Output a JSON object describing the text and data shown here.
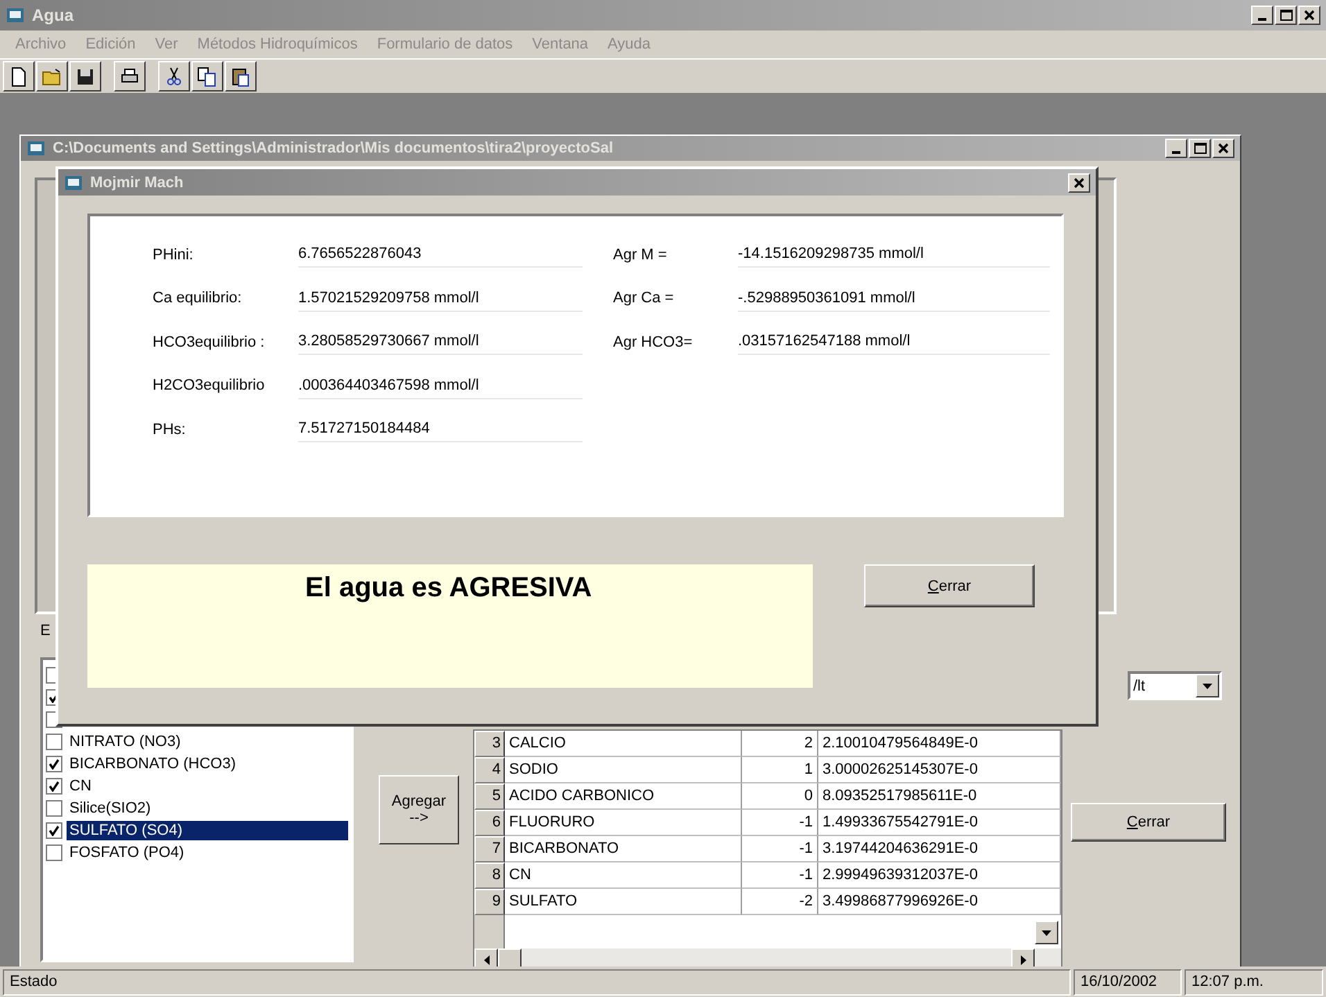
{
  "window": {
    "title": "Agua"
  },
  "menu": [
    "Archivo",
    "Edición",
    "Ver",
    "Métodos Hidroquímicos",
    "Formulario de datos",
    "Ventana",
    "Ayuda"
  ],
  "document_window": {
    "title": "C:\\Documents and Settings\\Administrador\\Mis documentos\\tira2\\proyectoSal",
    "label": "E",
    "list": [
      {
        "checked": false
      },
      {
        "checked": true
      },
      {
        "checked": false
      },
      {
        "label": "NITRATO (NO3)",
        "checked": false,
        "selected": false
      },
      {
        "label": "BICARBONATO (HCO3)",
        "checked": true,
        "selected": false
      },
      {
        "label": "CN",
        "checked": true,
        "selected": false
      },
      {
        "label": "Silice(SIO2)",
        "checked": false,
        "selected": false
      },
      {
        "label": "SULFATO (SO4)",
        "checked": true,
        "selected": true
      },
      {
        "label": "FOSFATO (PO4)",
        "checked": false,
        "selected": false
      }
    ],
    "add_button": "Agregar\n-->",
    "grid_rows": [
      {
        "number": "3",
        "name": "CALCIO",
        "charge": "2",
        "value": "2.10010479564849E-0"
      },
      {
        "number": "4",
        "name": "SODIO",
        "charge": "1",
        "value": "3.00002625145307E-0"
      },
      {
        "number": "5",
        "name": "ACIDO CARBONICO",
        "charge": "0",
        "value": "8.09352517985611E-0"
      },
      {
        "number": "6",
        "name": "FLUORURO",
        "charge": "-1",
        "value": "1.49933675542791E-0"
      },
      {
        "number": "7",
        "name": "BICARBONATO",
        "charge": "-1",
        "value": "3.19744204636291E-0"
      },
      {
        "number": "8",
        "name": "CN",
        "charge": "-1",
        "value": "2.99949639312037E-0"
      },
      {
        "number": "9",
        "name": "SULFATO",
        "charge": "-2",
        "value": "3.49986877996926E-0"
      }
    ],
    "combo": {
      "value": "/lt"
    },
    "close_button": "Cerrar"
  },
  "dialog": {
    "title": "Mojmir Mach",
    "left_fields": [
      {
        "label": "PHini:",
        "value": "6.7656522876043"
      },
      {
        "label": "Ca equilibrio:",
        "value": "1.57021529209758 mmol/l"
      },
      {
        "label": "HCO3equilibrio :",
        "value": "3.28058529730667 mmol/l"
      },
      {
        "label": "H2CO3equilibrio",
        "value": ".000364403467598 mmol/l"
      },
      {
        "label": "PHs:",
        "value": "7.51727150184484"
      }
    ],
    "right_fields": [
      {
        "label": "Agr M =",
        "value": "-14.1516209298735 mmol/l"
      },
      {
        "label": "Agr Ca =",
        "value": "-.52988950361091 mmol/l"
      },
      {
        "label": "Agr HCO3=",
        "value": ".03157162547188 mmol/l"
      }
    ],
    "message": "El agua es AGRESIVA",
    "close_button": "Cerrar"
  },
  "status_bar": {
    "text": "Estado",
    "date": "16/10/2002",
    "time": "12:07 p.m."
  }
}
